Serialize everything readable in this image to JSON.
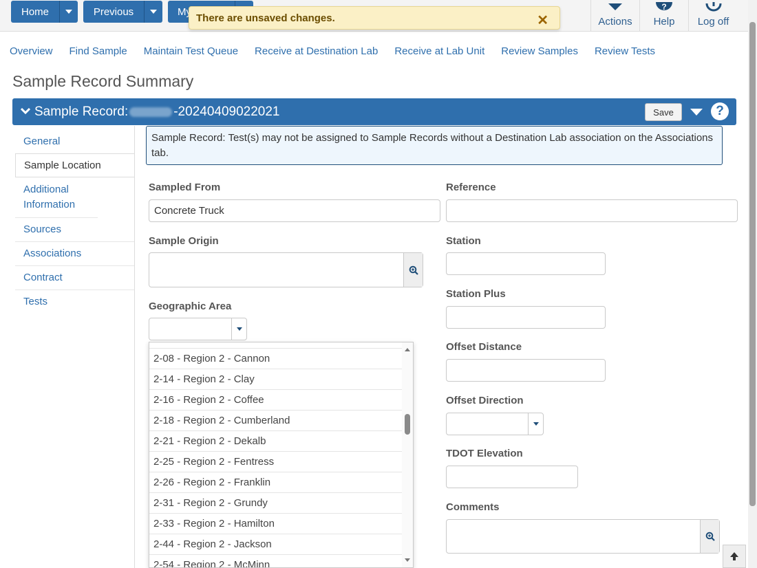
{
  "topbar": {
    "home_label": "Home",
    "previous_label": "Previous",
    "my_label": "My",
    "actions_label": "Actions",
    "help_label": "Help",
    "logoff_label": "Log off"
  },
  "toast": {
    "message": "There are unsaved changes.",
    "close_glyph": "✕"
  },
  "nav": {
    "items": [
      "Overview",
      "Find Sample",
      "Maintain Test Queue",
      "Receive at Destination Lab",
      "Receive at Lab Unit",
      "Review Samples",
      "Review Tests"
    ]
  },
  "page": {
    "title": "Sample Record Summary"
  },
  "record": {
    "title_prefix": "Sample Record:",
    "title_suffix": "-20240409022021",
    "save_label": "Save"
  },
  "tabs": [
    "General",
    "Sample Location",
    "Additional Information",
    "Sources",
    "Associations",
    "Contract",
    "Tests"
  ],
  "active_tab": "Sample Location",
  "info_message": "Sample Record: Test(s) may not be assigned to Sample Records without a Destination Lab association on the Associations tab.",
  "form": {
    "sampled_from": {
      "label": "Sampled From",
      "value": "Concrete Truck"
    },
    "reference": {
      "label": "Reference",
      "value": ""
    },
    "sample_origin": {
      "label": "Sample Origin",
      "value": ""
    },
    "station": {
      "label": "Station",
      "value": ""
    },
    "geographic_area": {
      "label": "Geographic Area",
      "value": ""
    },
    "station_plus": {
      "label": "Station Plus",
      "value": ""
    },
    "offset_distance": {
      "label": "Offset Distance",
      "value": ""
    },
    "offset_direction": {
      "label": "Offset Direction",
      "value": ""
    },
    "tdot_elevation": {
      "label": "TDOT Elevation",
      "value": ""
    },
    "comments": {
      "label": "Comments",
      "value": ""
    }
  },
  "geo_options": [
    "2-08 - Region 2 - Cannon",
    "2-14 - Region 2 - Clay",
    "2-16 - Region 2 - Coffee",
    "2-18 - Region 2 - Cumberland",
    "2-21 - Region 2 - Dekalb",
    "2-25 - Region 2 - Fentress",
    "2-26 - Region 2 - Franklin",
    "2-31 - Region 2 - Grundy",
    "2-33 - Region 2 - Hamilton",
    "2-44 - Region 2 - Jackson",
    "2-54 - Region 2 - McMinn"
  ],
  "colors": {
    "primary": "#2f6fad",
    "link": "#2f6fad",
    "toast_bg": "#fbf0c6",
    "info_bg": "#eef6fd"
  }
}
